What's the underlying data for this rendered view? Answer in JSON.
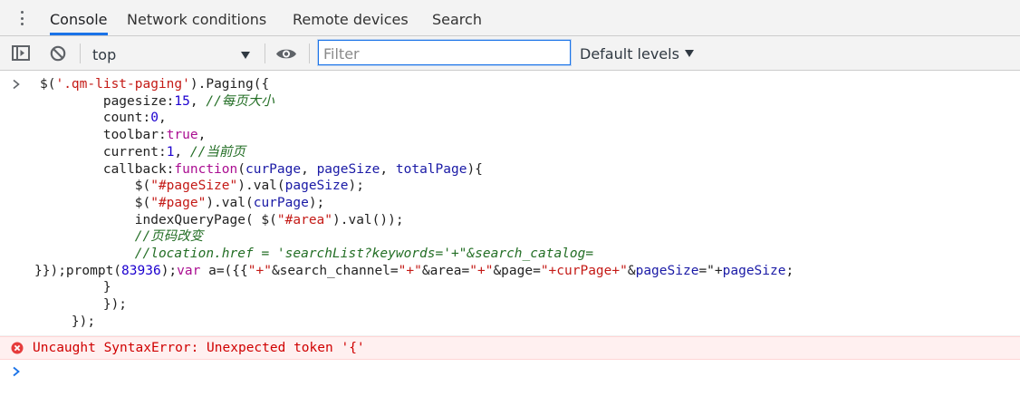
{
  "tabs": [
    "Console",
    "Network conditions",
    "Remote devices",
    "Search"
  ],
  "toolbar": {
    "context": "top",
    "filter_placeholder": "Filter",
    "levels_label": "Default levels"
  },
  "icons": {
    "menu": "kebab-menu-icon",
    "sidebar": "sidebar-toggle-icon",
    "clear": "clear-console-icon",
    "eye": "live-expression-eye-icon",
    "caret": "dropdown-caret-icon",
    "prompt": "chevron-right-icon",
    "error": "error-circle-icon"
  },
  "colors": {
    "accent": "#1a73e8",
    "error_text": "#d00000",
    "error_bg": "#fff0f0"
  },
  "console": {
    "code_lines": [
      "$('.qm-list-paging').Paging({",
      "        pagesize:15, //每页大小",
      "        count:0,",
      "        toolbar:true,",
      "        current:1, //当前页",
      "        callback:function(curPage, pageSize, totalPage){",
      "            $(\"#pageSize\").val(pageSize);",
      "            $(\"#page\").val(curPage);",
      "            indexQueryPage( $(\"#area\").val());",
      "            //页码改变",
      "            //location.href = 'searchList?keywords='+\"&search_catalog=",
      "}});prompt(83936);var a=({{\"+\"&search_channel=\"+\"&area=\"+\"&page=\"+curPage+\"&pageSize=\"+pageSize;",
      "        }",
      "        });",
      "    });"
    ],
    "error_message": "Uncaught SyntaxError: Unexpected token '{'"
  }
}
